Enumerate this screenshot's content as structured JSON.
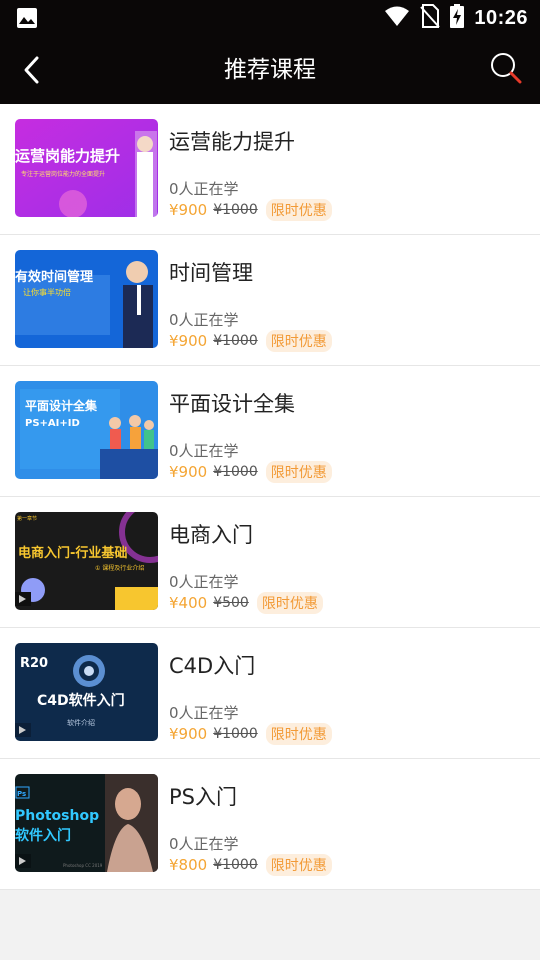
{
  "status_bar": {
    "time": "10:26"
  },
  "app_bar": {
    "title": "推荐课程"
  },
  "courses": [
    {
      "title": "运营能力提升",
      "learners": "0人正在学",
      "price": "¥900",
      "original_price": "¥1000",
      "badge": "限时优惠",
      "thumb": {
        "text": "运营岗能力提升",
        "subtext": "专注于运营岗位能力的全面提升"
      }
    },
    {
      "title": "时间管理",
      "learners": "0人正在学",
      "price": "¥900",
      "original_price": "¥1000",
      "badge": "限时优惠",
      "thumb": {
        "text": "有效时间管理",
        "subtext": "让你事半功倍"
      }
    },
    {
      "title": "平面设计全集",
      "learners": "0人正在学",
      "price": "¥900",
      "original_price": "¥1000",
      "badge": "限时优惠",
      "thumb": {
        "text": "平面设计全集",
        "subtext": "PS+AI+ID"
      }
    },
    {
      "title": "电商入门",
      "learners": "0人正在学",
      "price": "¥400",
      "original_price": "¥500",
      "badge": "限时优惠",
      "thumb": {
        "text": "电商入门-行业基础",
        "subtext": "① 课程及行业介绍",
        "badge_text": "第一章节"
      }
    },
    {
      "title": "C4D入门",
      "learners": "0人正在学",
      "price": "¥900",
      "original_price": "¥1000",
      "badge": "限时优惠",
      "thumb": {
        "text": "C4D软件入门",
        "subtext": "软件介绍",
        "badge_text": "R20"
      }
    },
    {
      "title": "PS入门",
      "learners": "0人正在学",
      "price": "¥800",
      "original_price": "¥1000",
      "badge": "限时优惠",
      "thumb": {
        "text": "Photoshop",
        "subtext": "软件入门",
        "badge_text": "Ps",
        "footer_text": "Photoshop CC 2019"
      }
    }
  ],
  "colors": {
    "bar": "#0a0707",
    "price": "#f4a534",
    "badge_bg": "#fdeedd"
  }
}
